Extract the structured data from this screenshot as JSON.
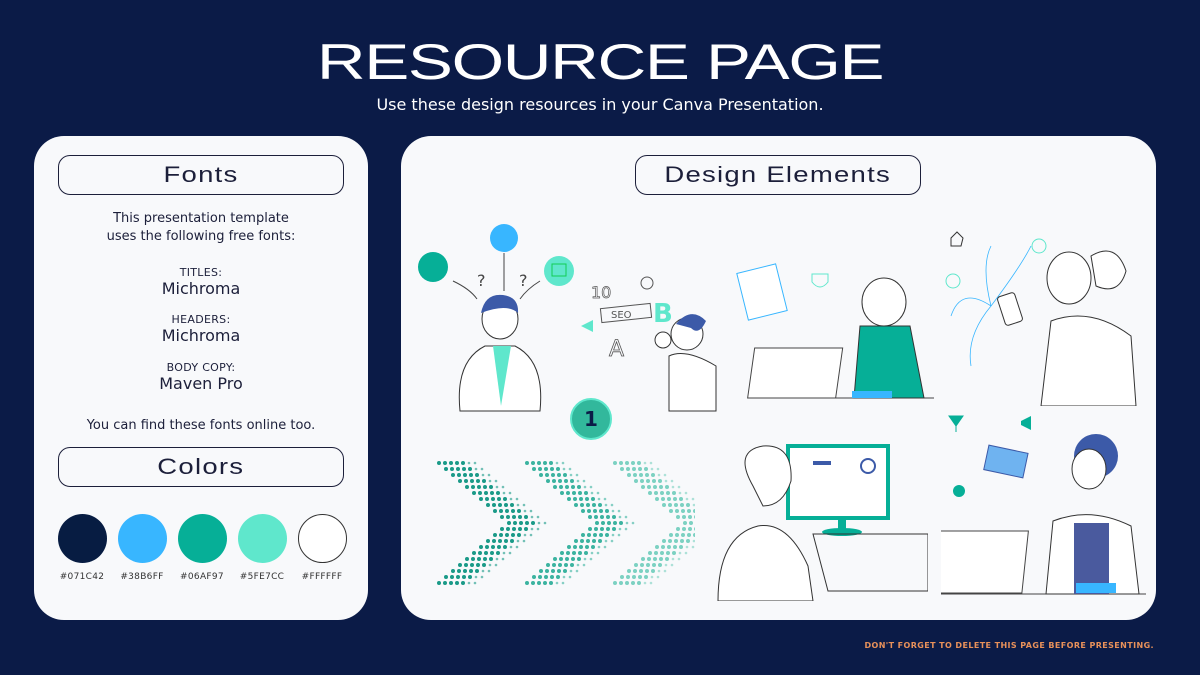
{
  "header": {
    "title": "RESOURCE PAGE",
    "subtitle": "Use these design resources in your Canva Presentation."
  },
  "fonts_panel": {
    "heading": "Fonts",
    "intro_line1": "This presentation template",
    "intro_line2": "uses the following free fonts:",
    "entries": [
      {
        "label": "TITLES:",
        "font": "Michroma"
      },
      {
        "label": "HEADERS:",
        "font": "Michroma"
      },
      {
        "label": "BODY COPY:",
        "font": "Maven Pro"
      }
    ],
    "footer": "You can find these fonts online too."
  },
  "colors_panel": {
    "heading": "Colors",
    "swatches": [
      {
        "hex": "#071C42",
        "color": "#071C42"
      },
      {
        "hex": "#38B6FF",
        "color": "#38B6FF"
      },
      {
        "hex": "#06AF97",
        "color": "#06AF97"
      },
      {
        "hex": "#5FE7CC",
        "color": "#5FE7CC"
      },
      {
        "hex": "#FFFFFF",
        "color": "#FFFFFF"
      }
    ]
  },
  "design_elements": {
    "heading": "Design Elements",
    "items": [
      {
        "name": "confused-person-illustration"
      },
      {
        "name": "seo-magnifier-illustration"
      },
      {
        "name": "summary-laptop-illustration"
      },
      {
        "name": "social-phone-illustration"
      },
      {
        "name": "number-one-badge",
        "text": "1"
      },
      {
        "name": "dotted-chevrons"
      },
      {
        "name": "designer-monitor-illustration"
      },
      {
        "name": "marketing-laptop-illustration"
      }
    ],
    "seo_text": "SEO",
    "ten_text": "10",
    "b_text": "B",
    "a_text": "A"
  },
  "footer_note": "DON'T FORGET TO DELETE THIS PAGE BEFORE PRESENTING."
}
